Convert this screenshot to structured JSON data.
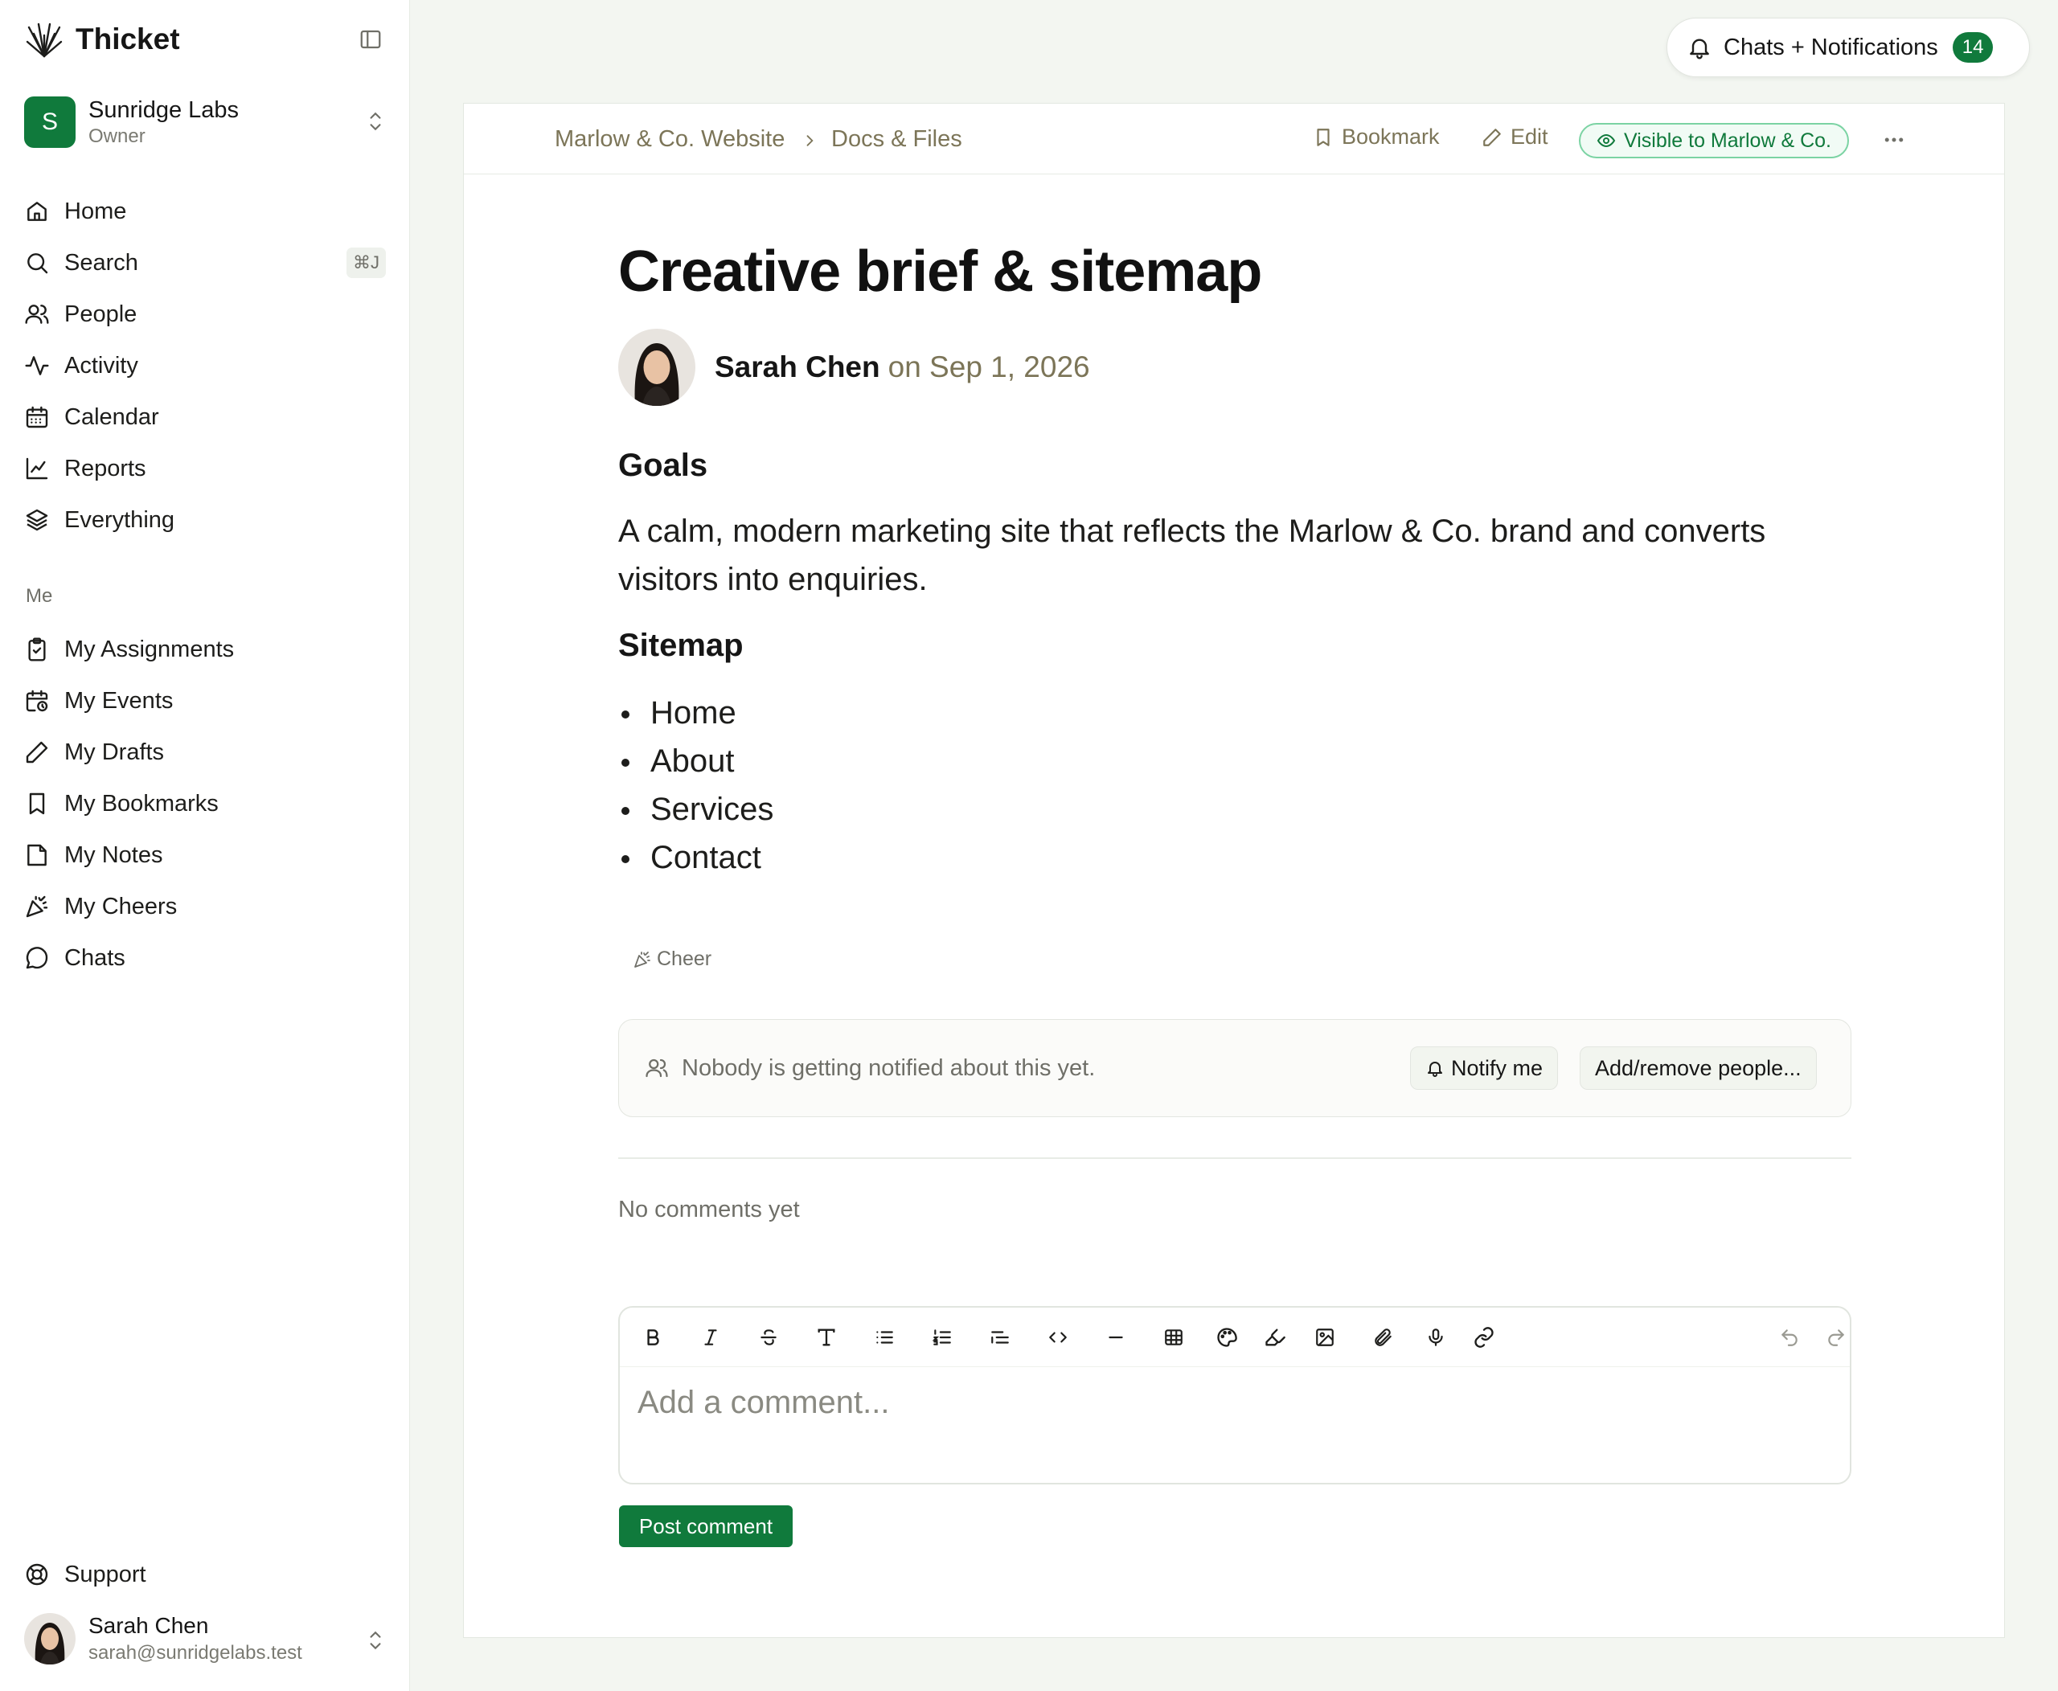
{
  "app": {
    "name": "Thicket"
  },
  "workspace": {
    "initial": "S",
    "name": "Sunridge Labs",
    "role": "Owner"
  },
  "nav": {
    "home": "Home",
    "search": "Search",
    "search_shortcut": "⌘J",
    "people": "People",
    "activity": "Activity",
    "calendar": "Calendar",
    "reports": "Reports",
    "everything": "Everything"
  },
  "me": {
    "section_label": "Me",
    "assignments": "My Assignments",
    "events": "My Events",
    "drafts": "My Drafts",
    "bookmarks": "My Bookmarks",
    "notes": "My Notes",
    "cheers": "My Cheers",
    "chats": "Chats"
  },
  "support": "Support",
  "user": {
    "name": "Sarah Chen",
    "email": "sarah@sunridgelabs.test"
  },
  "notifications": {
    "label": "Chats + Notifications",
    "count": "14"
  },
  "breadcrumb": {
    "project": "Marlow & Co. Website",
    "section": "Docs & Files"
  },
  "doc_toolbar": {
    "bookmark": "Bookmark",
    "edit": "Edit",
    "visibility": "Visible to Marlow & Co."
  },
  "doc": {
    "title": "Creative brief & sitemap",
    "author": "Sarah Chen",
    "date": "on Sep 1, 2026",
    "goals_heading": "Goals",
    "goals_text": "A calm, modern marketing site that reflects the Marlow & Co. brand and converts visitors into enquiries.",
    "sitemap_heading": "Sitemap",
    "sitemap": [
      "Home",
      "About",
      "Services",
      "Contact"
    ]
  },
  "cheer": "Cheer",
  "subscribers": {
    "message": "Nobody is getting notified about this yet.",
    "notify": "Notify me",
    "add_remove": "Add/remove people..."
  },
  "comments": {
    "empty": "No comments yet",
    "placeholder": "Add a comment...",
    "post": "Post comment"
  },
  "colors": {
    "accent": "#107a3c",
    "muted_brown": "#7c7558",
    "background": "#f3f6f1"
  }
}
